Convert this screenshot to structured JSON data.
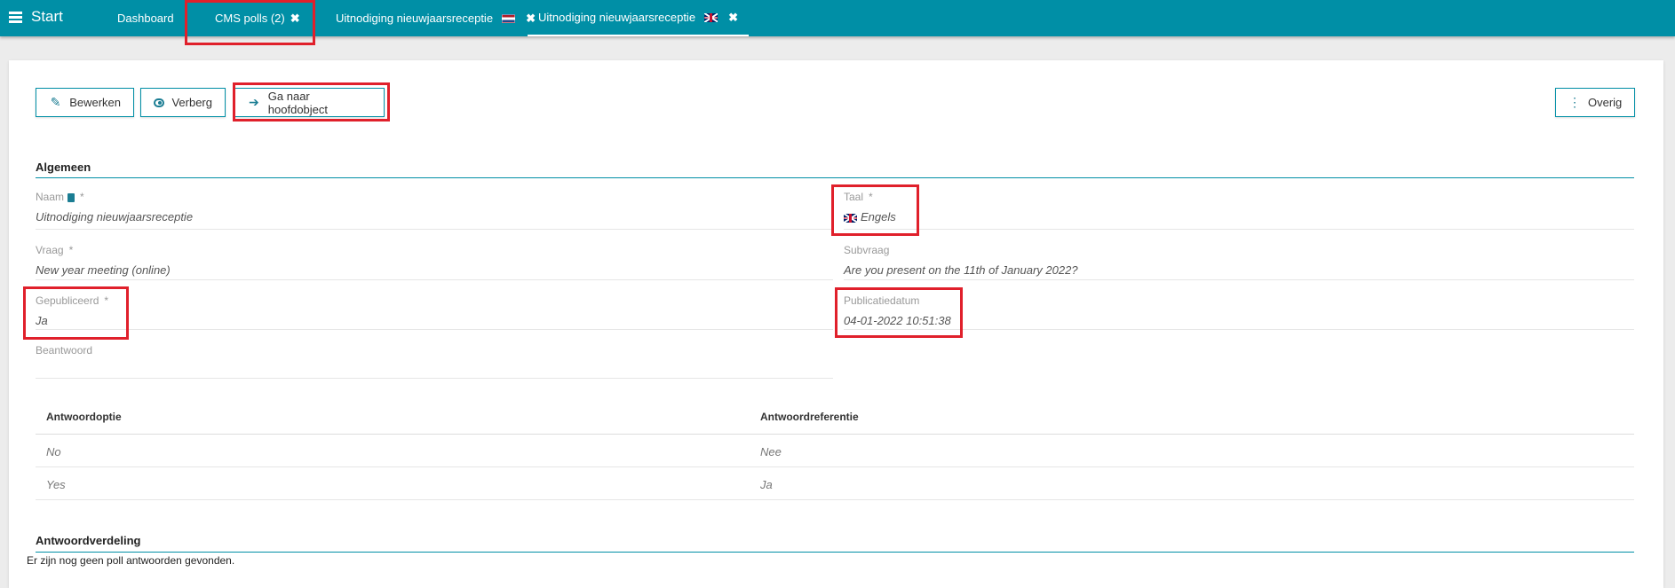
{
  "topbar": {
    "start_label": "Start",
    "tabs": [
      {
        "label": "Dashboard"
      },
      {
        "label": "CMS polls (2)",
        "close": "✖"
      },
      {
        "label": "Uitnodiging nieuwjaarsreceptie",
        "close": "✖",
        "flag": "nl-flag-icon"
      },
      {
        "label": "Uitnodiging nieuwjaarsreceptie",
        "close": "✖",
        "flag": "uk-flag-icon"
      }
    ]
  },
  "toolbar": {
    "edit_label": "Bewerken",
    "hide_label": "Verberg",
    "goto_label": "Ga naar hoofdobject",
    "more_label": "Overig"
  },
  "general": {
    "title": "Algemeen",
    "name_label": "Naam",
    "name_value": "Uitnodiging nieuwjaarsreceptie",
    "language_label": "Taal",
    "language_value": "Engels",
    "question_label": "Vraag",
    "question_value": "New year meeting (online)",
    "subquestion_label": "Subvraag",
    "subquestion_value": "Are you present on the 11th of January 2022?",
    "published_label": "Gepubliceerd",
    "published_value": "Ja",
    "pubdate_label": "Publicatiedatum",
    "pubdate_value": "04-01-2022 10:51:38",
    "answered_label": "Beantwoord",
    "required_mark": "*"
  },
  "answers": {
    "headers": [
      "Antwoordoptie",
      "Antwoordreferentie"
    ],
    "rows": [
      [
        "No",
        "Nee"
      ],
      [
        "Yes",
        "Ja"
      ]
    ]
  },
  "distribution": {
    "title": "Antwoordverdeling",
    "message": "Er zijn nog geen poll antwoorden gevonden."
  },
  "colors": {
    "accent": "#008fa6",
    "highlight": "#e0202b"
  }
}
